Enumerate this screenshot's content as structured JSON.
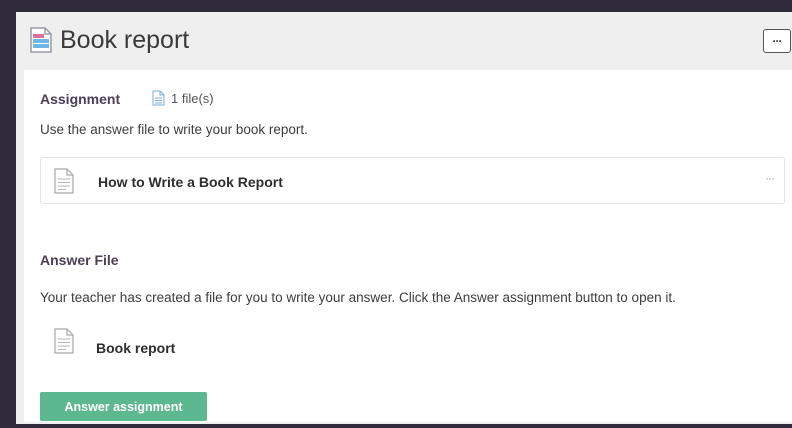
{
  "header": {
    "title": "Book report",
    "more_label": "···"
  },
  "assignment": {
    "heading": "Assignment",
    "files_count": "1 file(s)",
    "instructions": "Use the answer file to write your book report.",
    "file": {
      "name": "How to Write a Book Report",
      "more_label": "···"
    }
  },
  "answer_file": {
    "heading": "Answer File",
    "description": "Your teacher has created a file for you to write your answer. Click the Answer assignment button to open it.",
    "file_name": "Book report",
    "button_label": "Answer assignment"
  },
  "colors": {
    "background": "#2f2b3a",
    "panel": "#efefef",
    "accent_button": "#5cb88f",
    "heading": "#4c3e55"
  },
  "icons": {
    "header": "document-icon",
    "file": "file-icon"
  }
}
